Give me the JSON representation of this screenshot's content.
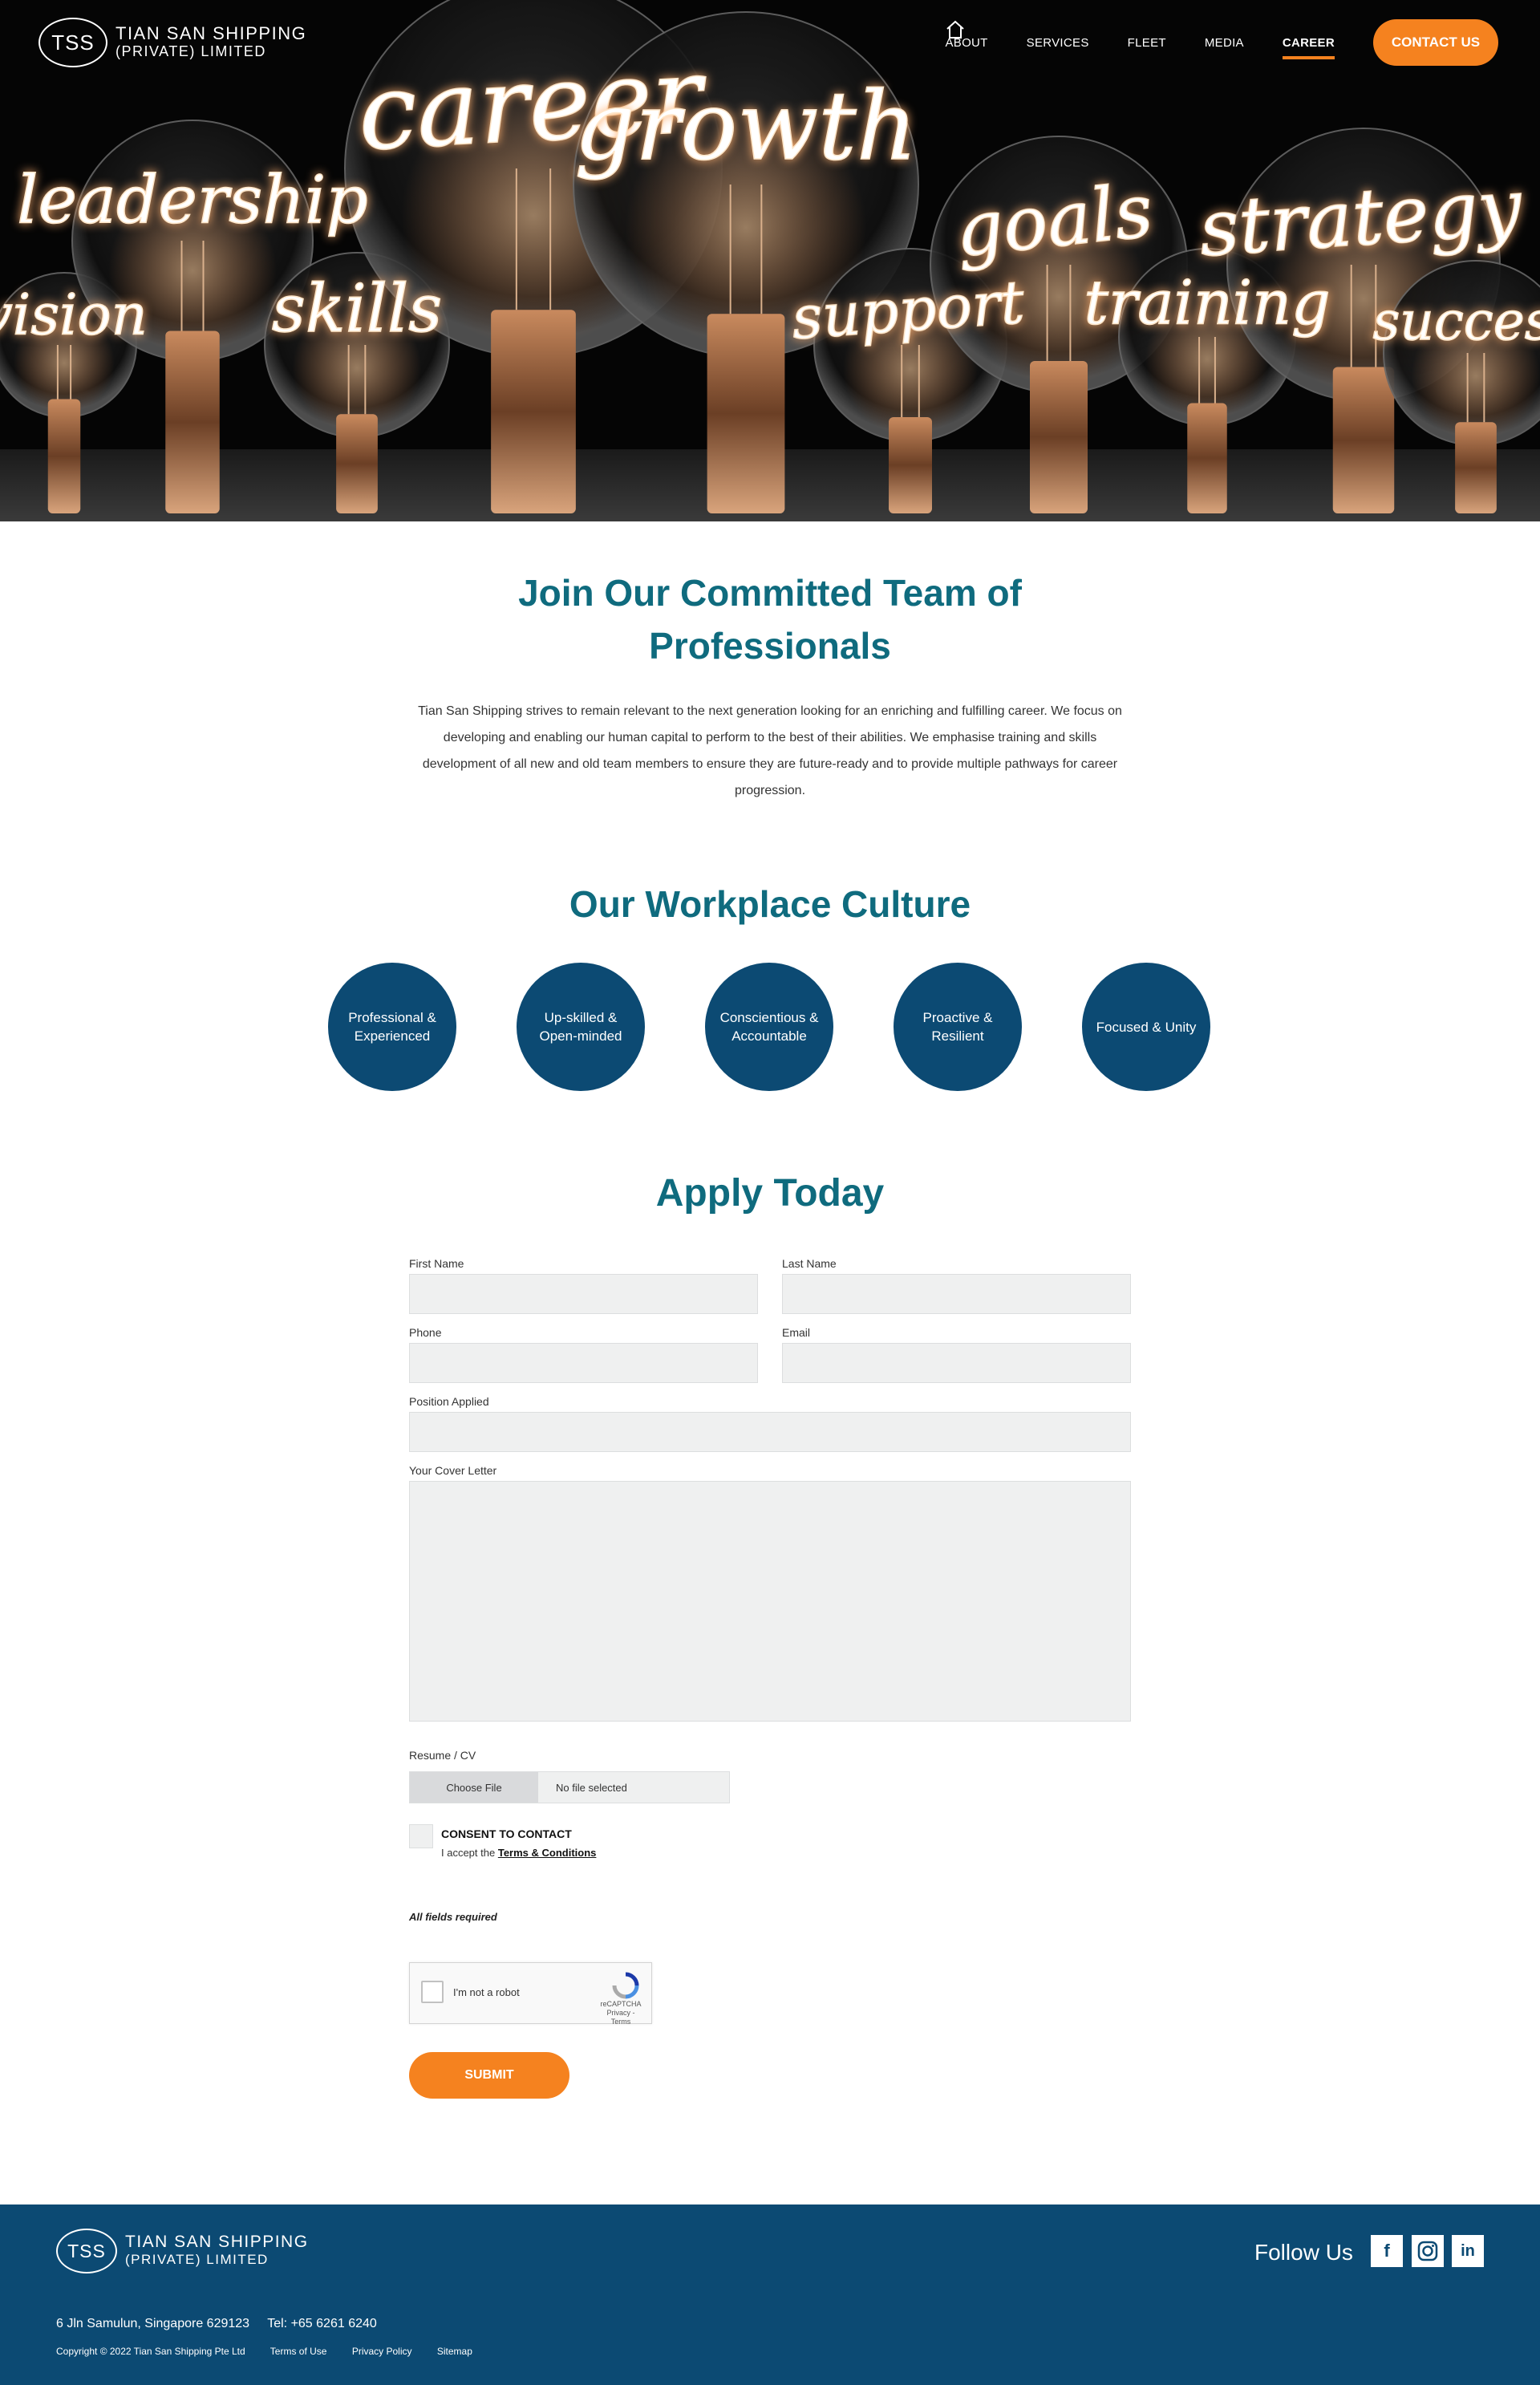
{
  "header": {
    "logo_mark": "TSS",
    "logo_line1": "TIAN SAN SHIPPING",
    "logo_line2": "(PRIVATE) LIMITED",
    "nav": [
      {
        "label": "ABOUT"
      },
      {
        "label": "SERVICES"
      },
      {
        "label": "FLEET"
      },
      {
        "label": "MEDIA"
      },
      {
        "label": "CAREER",
        "active": true
      }
    ],
    "contact_label": "CONTACT US"
  },
  "hero": {
    "words": [
      "vision",
      "leadership",
      "skills",
      "career",
      "growth",
      "support",
      "goals",
      "training",
      "strategy",
      "success"
    ]
  },
  "intro": {
    "title": "Join Our Committed Team of Professionals",
    "text": "Tian San Shipping strives to remain relevant to the next generation looking for an enriching and fulfilling career. We focus on developing and enabling our human capital to perform to the best of their abilities. We emphasise training and skills development of all new and old team members to ensure they are future-ready and to provide multiple pathways for career progression."
  },
  "culture": {
    "title": "Our Workplace Culture",
    "items": [
      "Professional & Experienced",
      "Up-skilled & Open-minded",
      "Conscientious & Accountable",
      "Proactive & Resilient",
      "Focused & Unity"
    ]
  },
  "form": {
    "title": "Apply Today",
    "first_name": "First Name",
    "last_name": "Last Name",
    "phone": "Phone",
    "email": "Email",
    "position": "Position Applied",
    "cover_letter": "Your Cover Letter",
    "resume": "Resume / CV",
    "choose_file": "Choose File",
    "no_file": "No file selected",
    "consent_title": "CONSENT TO CONTACT",
    "consent_text": "I accept the",
    "consent_link": "Terms & Conditions",
    "all_required": "All fields required",
    "captcha_text": "I'm not a robot",
    "captcha_brand": "reCAPTCHA",
    "captcha_links": "Privacy - Terms",
    "submit": "SUBMIT"
  },
  "footer": {
    "logo_mark": "TSS",
    "logo_line1": "TIAN SAN SHIPPING",
    "logo_line2": "(PRIVATE) LIMITED",
    "follow": "Follow Us",
    "social": [
      "f",
      "in"
    ],
    "address": "6 Jln Samulun, Singapore 629123",
    "tel": "Tel: +65 6261 6240",
    "copyright": "Copyright © 2022 Tian San Shipping Pte Ltd",
    "terms": "Terms of Use",
    "privacy": "Privacy Policy",
    "sitemap": "Sitemap"
  },
  "colors": {
    "accent": "#f5821f",
    "teal_heading": "#0f6b7e",
    "navy": "#0c4a73",
    "input_bg": "#eff0f0"
  }
}
